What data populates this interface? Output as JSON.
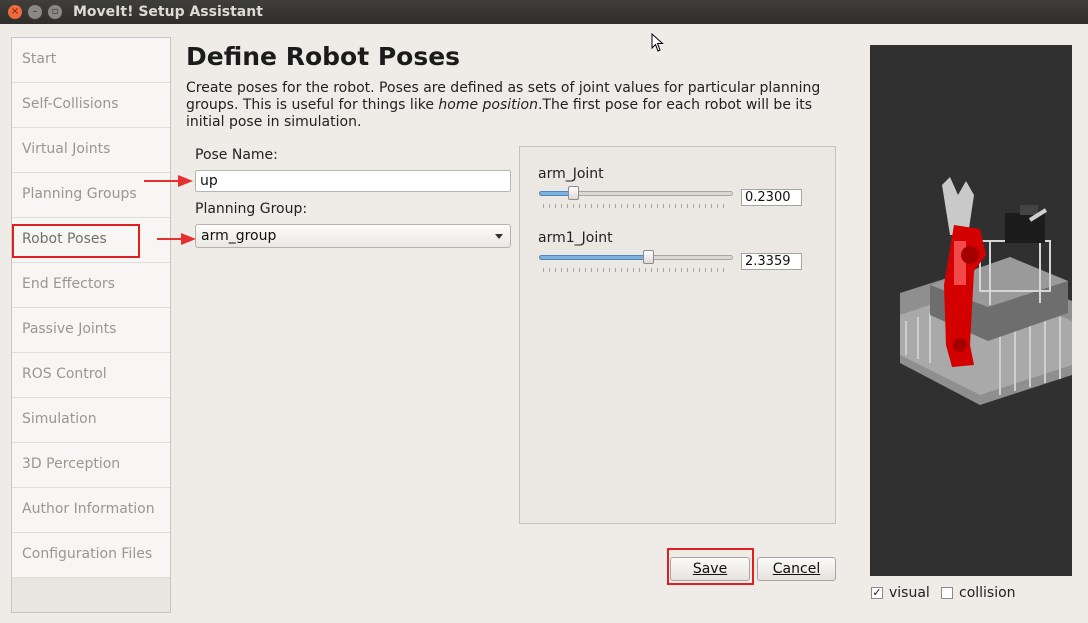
{
  "window": {
    "title": "MoveIt! Setup Assistant"
  },
  "sidebar": {
    "items": [
      {
        "label": "Start"
      },
      {
        "label": "Self-Collisions"
      },
      {
        "label": "Virtual Joints"
      },
      {
        "label": "Planning Groups"
      },
      {
        "label": "Robot Poses"
      },
      {
        "label": "End Effectors"
      },
      {
        "label": "Passive Joints"
      },
      {
        "label": "ROS Control"
      },
      {
        "label": "Simulation"
      },
      {
        "label": "3D Perception"
      },
      {
        "label": "Author Information"
      },
      {
        "label": "Configuration Files"
      }
    ],
    "active": "Robot Poses"
  },
  "main": {
    "title": "Define Robot Poses",
    "description_part1": "Create poses for the robot. Poses are defined as sets of joint values for particular planning groups. This is useful for things like ",
    "description_emph": "home position",
    "description_part2": ".The first pose for each robot will be its initial pose in simulation.",
    "pose_name_label": "Pose Name:",
    "pose_name_value": "up",
    "planning_group_label": "Planning Group:",
    "planning_group_value": "arm_group"
  },
  "joints": [
    {
      "name": "arm_Joint",
      "value": "0.2300",
      "slider_fraction": 0.16
    },
    {
      "name": "arm1_Joint",
      "value": "2.3359",
      "slider_fraction": 0.57
    }
  ],
  "buttons": {
    "save": "Save",
    "cancel": "Cancel"
  },
  "view_options": {
    "visual_label": "visual",
    "visual_checked": true,
    "collision_label": "collision",
    "collision_checked": false
  },
  "colors": {
    "highlight": "#e02020",
    "slider_fill": "#7fb0dc",
    "robot_highlight": "#d40000"
  }
}
